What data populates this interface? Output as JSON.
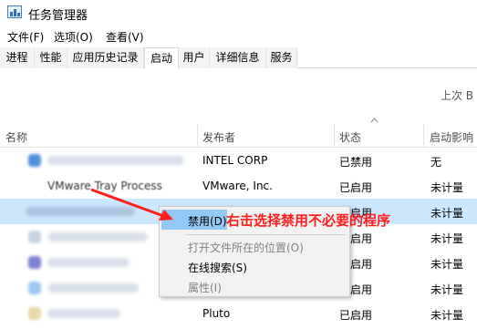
{
  "window": {
    "title": "任务管理器"
  },
  "menubar": {
    "file": "文件(F)",
    "options": "选项(O)",
    "view": "查看(V)"
  },
  "tabs": [
    {
      "label": "进程"
    },
    {
      "label": "性能"
    },
    {
      "label": "应用历史记录"
    },
    {
      "label": "启动",
      "active": true
    },
    {
      "label": "用户"
    },
    {
      "label": "详细信息"
    },
    {
      "label": "服务"
    }
  ],
  "last_bios": "上次 B",
  "columns": {
    "name": "名称",
    "publisher": "发布者",
    "status": "状态",
    "impact": "启动影响"
  },
  "rows": [
    {
      "name": "",
      "publisher": "INTEL CORP",
      "status": "已禁用",
      "impact": "无"
    },
    {
      "name": "VMware Tray Process",
      "publisher": "VMware, Inc.",
      "status": "已启用",
      "impact": "未计量"
    },
    {
      "name": "",
      "publisher": "",
      "status": "已启用",
      "impact": "未计量",
      "selected": true
    },
    {
      "name": "",
      "publisher": "",
      "status": "已启用",
      "impact": "未计量"
    },
    {
      "name": "",
      "publisher": "",
      "status": "已启用",
      "impact": "未计量"
    },
    {
      "name": "",
      "publisher": "",
      "status": "已启用",
      "impact": "未计量"
    },
    {
      "name": "",
      "publisher": "Pluto",
      "status": "已启用",
      "impact": "未计量"
    }
  ],
  "context_menu": {
    "disable": "禁用(D)",
    "open_location": "打开文件所在的位置(O)",
    "search_online": "在线搜索(S)",
    "properties": "属性(I)"
  },
  "annotation": "右击选择禁用不必要的程序",
  "colors": {
    "annotation": "#ff1f1f",
    "selection": "#cce8ff",
    "menu_highlight": "#91c9f7"
  }
}
